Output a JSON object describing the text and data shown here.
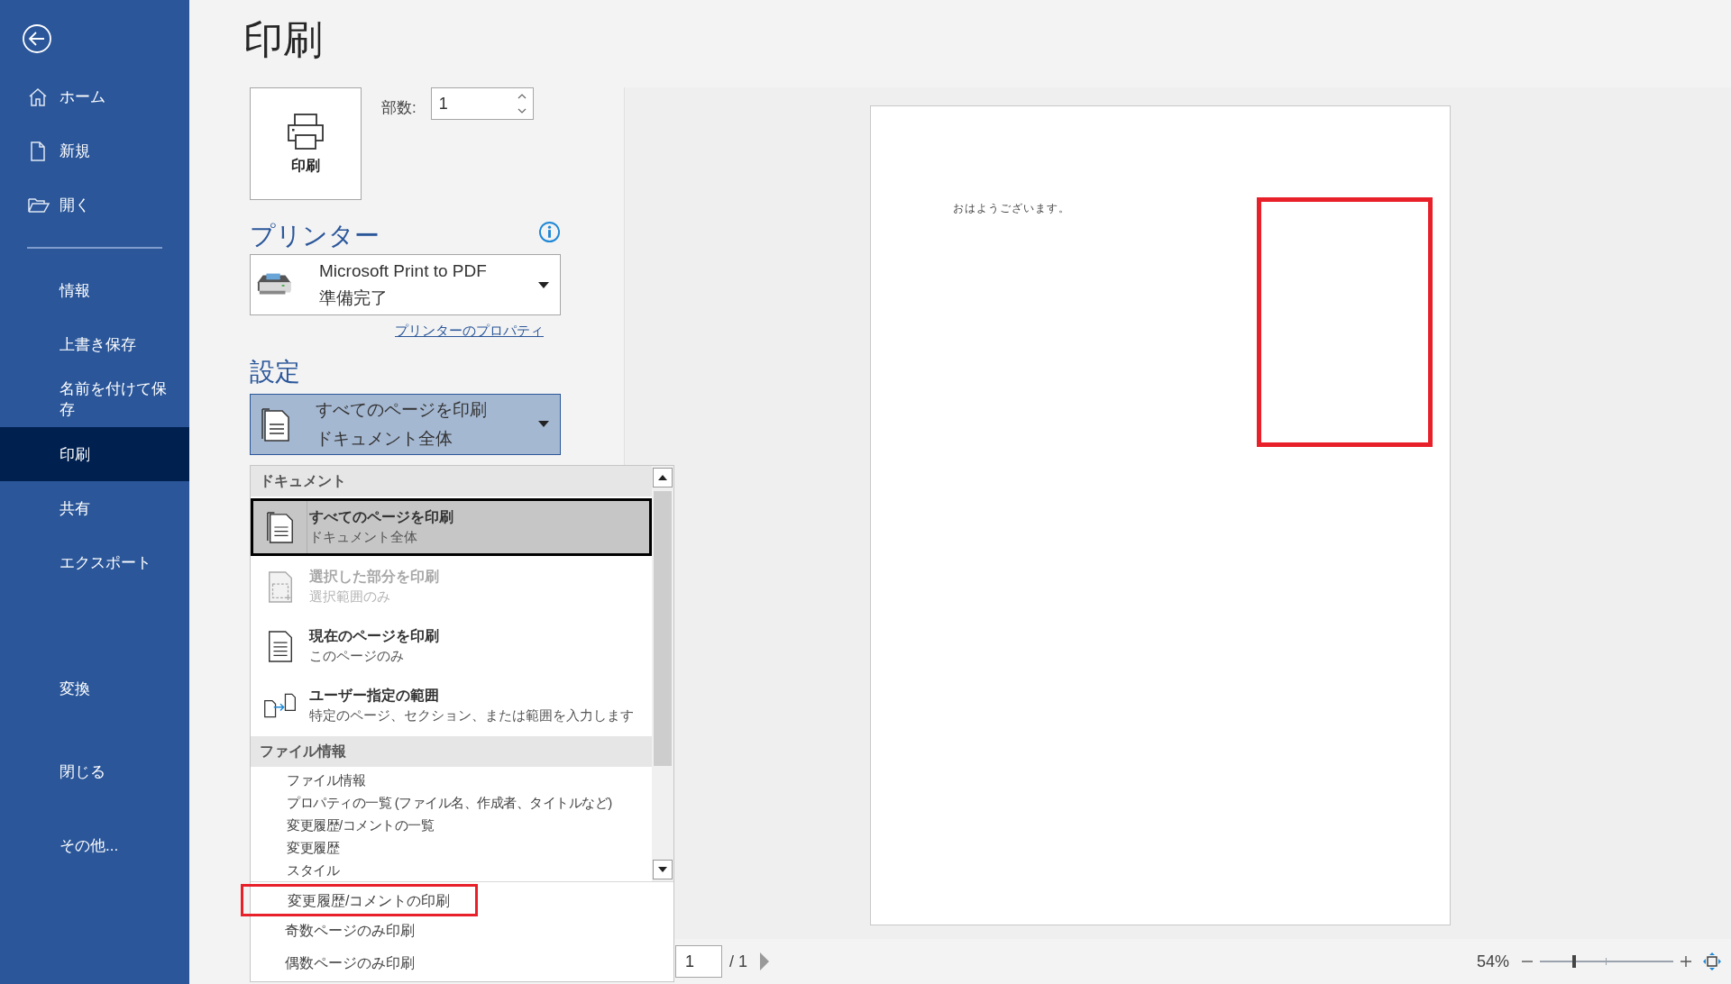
{
  "sidebar": {
    "top_items": [
      {
        "kind": "home",
        "label": "ホーム",
        "selected": false
      },
      {
        "kind": "new",
        "label": "新規",
        "selected": false
      },
      {
        "kind": "open",
        "label": "開く",
        "selected": false
      }
    ],
    "items": [
      {
        "label": "情報",
        "selected": false
      },
      {
        "label": "上書き保存",
        "selected": false
      },
      {
        "label": "名前を付けて保存",
        "selected": false
      },
      {
        "label": "印刷",
        "selected": true
      },
      {
        "label": "共有",
        "selected": false
      },
      {
        "label": "エクスポート",
        "selected": false
      },
      {
        "label": "変換",
        "selected": false
      },
      {
        "label": "閉じる",
        "selected": false
      },
      {
        "label": "その他...",
        "selected": false
      }
    ]
  },
  "page_title": "印刷",
  "print_button": {
    "label": "印刷"
  },
  "copies": {
    "label": "部数:",
    "value": "1"
  },
  "printer": {
    "heading": "プリンター",
    "name": "Microsoft Print to PDF",
    "status": "準備完了",
    "properties_link": "プリンターのプロパティ"
  },
  "settings": {
    "heading": "設定",
    "title": "すべてのページを印刷",
    "subtitle": "ドキュメント全体",
    "expanded": true
  },
  "dropdown": {
    "sections": [
      {
        "heading": "ドキュメント",
        "items": [
          {
            "kind": "all",
            "title": "すべてのページを印刷",
            "subtitle": "ドキュメント全体",
            "selected": true,
            "disabled": false
          },
          {
            "kind": "selection",
            "title": "選択した部分を印刷",
            "subtitle": "選択範囲のみ",
            "selected": false,
            "disabled": true
          },
          {
            "kind": "current",
            "title": "現在のページを印刷",
            "subtitle": "このページのみ",
            "selected": false,
            "disabled": false
          },
          {
            "kind": "custom",
            "title": "ユーザー指定の範囲",
            "subtitle": "特定のページ、セクション、または範囲を入力します",
            "selected": false,
            "disabled": false
          }
        ]
      },
      {
        "heading": "ファイル情報",
        "items": [
          {
            "kind": "text",
            "title": "ファイル情報"
          },
          {
            "kind": "text",
            "title": "プロパティの一覧 (ファイル名、作成者、タイトルなど)"
          },
          {
            "kind": "text",
            "title": "変更履歴/コメントの一覧"
          },
          {
            "kind": "text",
            "title": "変更履歴"
          },
          {
            "kind": "text",
            "title": "スタイル"
          }
        ]
      }
    ],
    "extra_items": [
      {
        "label": "変更履歴/コメントの印刷",
        "highlighted": true
      },
      {
        "label": "奇数ページのみ印刷",
        "highlighted": false
      },
      {
        "label": "偶数ページのみ印刷",
        "highlighted": false
      }
    ]
  },
  "preview": {
    "text": "おはようございます。",
    "highlight_frame": true
  },
  "pager": {
    "page": "1",
    "total": "/ 1"
  },
  "zoom": {
    "reading": "54%",
    "level": 0.25
  }
}
